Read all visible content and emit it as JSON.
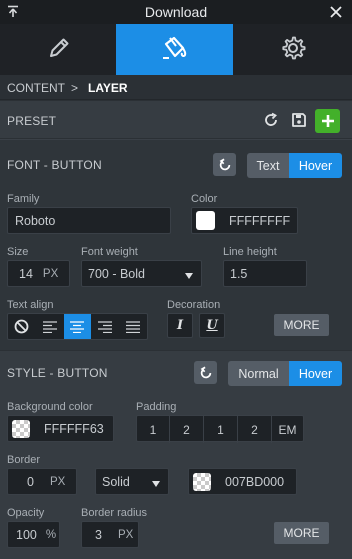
{
  "window": {
    "title": "Download"
  },
  "tabs": [
    {
      "name": "edit"
    },
    {
      "name": "style"
    },
    {
      "name": "settings"
    }
  ],
  "breadcrumb": {
    "content": "CONTENT",
    "separator": ">",
    "layer": "LAYER"
  },
  "preset": {
    "label": "PRESET"
  },
  "font_section": {
    "label": "FONT - BUTTON",
    "toggle": {
      "text": "Text",
      "hover": "Hover",
      "active": "hover"
    }
  },
  "font": {
    "family_label": "Family",
    "family_value": "Roboto",
    "color_label": "Color",
    "color_value": "FFFFFFFF",
    "size_label": "Size",
    "size_value": "14",
    "size_unit": "PX",
    "weight_label": "Font weight",
    "weight_value": "700 - Bold",
    "line_height_label": "Line height",
    "line_height_value": "1.5",
    "text_align_label": "Text align",
    "decoration_label": "Decoration",
    "more_label": "MORE"
  },
  "style_section": {
    "label": "STYLE - BUTTON",
    "toggle": {
      "normal": "Normal",
      "hover": "Hover",
      "active": "hover"
    }
  },
  "style": {
    "bg_label": "Background color",
    "bg_value": "FFFFFF63",
    "padding_label": "Padding",
    "padding": [
      "1",
      "2",
      "1",
      "2"
    ],
    "padding_unit": "EM",
    "border_label": "Border",
    "border_width": "0",
    "border_unit": "PX",
    "border_style": "Solid",
    "border_color": "007BD000",
    "opacity_label": "Opacity",
    "opacity_value": "100",
    "opacity_unit": "%",
    "radius_label": "Border radius",
    "radius_value": "3",
    "radius_unit": "PX",
    "more_label": "MORE"
  },
  "colors": {
    "accent": "#1c8ee6",
    "add": "#43b02a"
  }
}
